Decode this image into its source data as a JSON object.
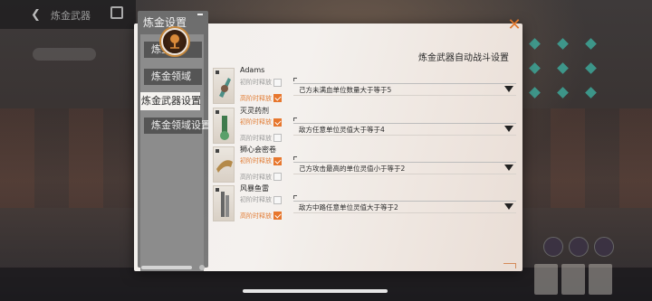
{
  "background": {
    "top_title": "炼金武器"
  },
  "sidebar": {
    "title": "炼金设置",
    "tabs": [
      {
        "label": "炼金",
        "active": false
      },
      {
        "label": "炼金领域",
        "active": false
      },
      {
        "label": "炼金武器设置",
        "active": true
      },
      {
        "label": "炼金领域设置",
        "active": false
      }
    ]
  },
  "panel": {
    "title": "炼金武器自动战斗设置",
    "close_icon": "close-x-icon",
    "accent_color": "#e7772e"
  },
  "weapons": [
    {
      "name": "Adams",
      "opt1_label": "初阶时释放",
      "opt1_checked": false,
      "opt2_label": "高阶时释放",
      "opt2_checked": true,
      "condition": "己方未满血单位数量大于等于5"
    },
    {
      "name": "灭灵药剂",
      "opt1_label": "初阶时释放",
      "opt1_checked": true,
      "opt2_label": "高阶时释放",
      "opt2_checked": false,
      "condition": "敌方任意单位灵值大于等于4"
    },
    {
      "name": "狮心会密卷",
      "opt1_label": "初阶时释放",
      "opt1_checked": true,
      "opt2_label": "高阶时释放",
      "opt2_checked": false,
      "condition": "己方攻击最高的单位灵值小于等于2"
    },
    {
      "name": "风暴鱼雷",
      "opt1_label": "初阶时释放",
      "opt1_checked": false,
      "opt2_label": "高阶时释放",
      "opt2_checked": true,
      "condition": "敌方中路任意单位灵值大于等于2"
    }
  ]
}
